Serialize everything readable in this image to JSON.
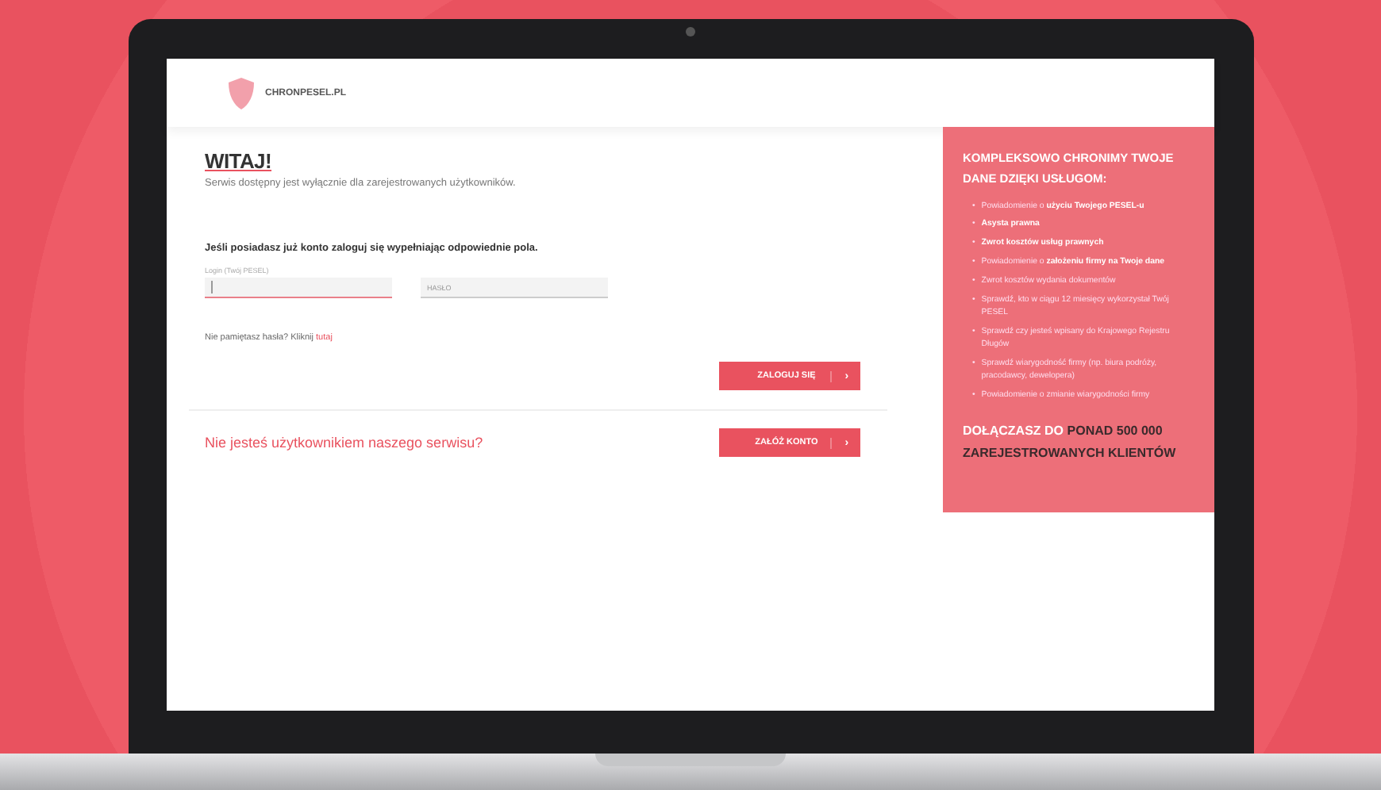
{
  "logo": {
    "text": "CHRONPESEL.PL"
  },
  "login": {
    "heading": "WITAJ!",
    "subtitle": "Serwis dostępny jest wyłącznie dla zarejestrowanych użytkowników.",
    "prompt": "Jeśli posiadasz już konto zaloguj się wypełniając odpowiednie pola.",
    "fields": [
      {
        "label": "Login (Twój PESEL)",
        "focused": true
      },
      {
        "placeholder": "HASŁO",
        "focused": false
      }
    ],
    "forgot": {
      "text": "Nie pamiętasz hasła? Kliknij",
      "link": "tutaj"
    },
    "button": {
      "label": "ZALOGUJ SIĘ",
      "arrow": "›"
    }
  },
  "register": {
    "question": "Nie jesteś użytkownikiem naszego serwisu?",
    "button": {
      "label": "ZAŁÓŻ KONTO",
      "arrow": "›"
    }
  },
  "panel": {
    "title": "KOMPLEKSOWO CHRONIMY TWOJE DANE DZIĘKI USŁUGOM:",
    "services": [
      {
        "bullet": "•",
        "text": "Powiadomienie o **użyciu Twojego PESEL-u**"
      },
      {
        "bullet": "•",
        "text": "**Asysta prawna**"
      },
      {
        "bullet": "•",
        "text": "**Zwrot kosztów usług prawnych**"
      },
      {
        "bullet": "•",
        "text": "Powiadomienie o **założeniu firmy na Twoje dane**"
      },
      {
        "bullet": "•",
        "text": "Zwrot kosztów wydania dokumentów"
      },
      {
        "bullet": "•",
        "text": "Sprawdź, kto w ciągu 12 miesięcy wykorzystał Twój PESEL"
      },
      {
        "bullet": "•",
        "text": "Sprawdź czy jesteś wpisany do Krajowego Rejestru Długów"
      },
      {
        "bullet": "•",
        "text": "Sprawdź wiarygodność firmy (np. biura podróży, pracodawcy, dewelopera)"
      },
      {
        "bullet": "•",
        "text": "Powiadomienie o zmianie wiarygodności firmy"
      }
    ],
    "footer_lead": "DOŁĄCZASZ DO",
    "footer_highlight": "PONAD 500 000 ZAREJESTROWANYCH KLIENTÓW"
  }
}
